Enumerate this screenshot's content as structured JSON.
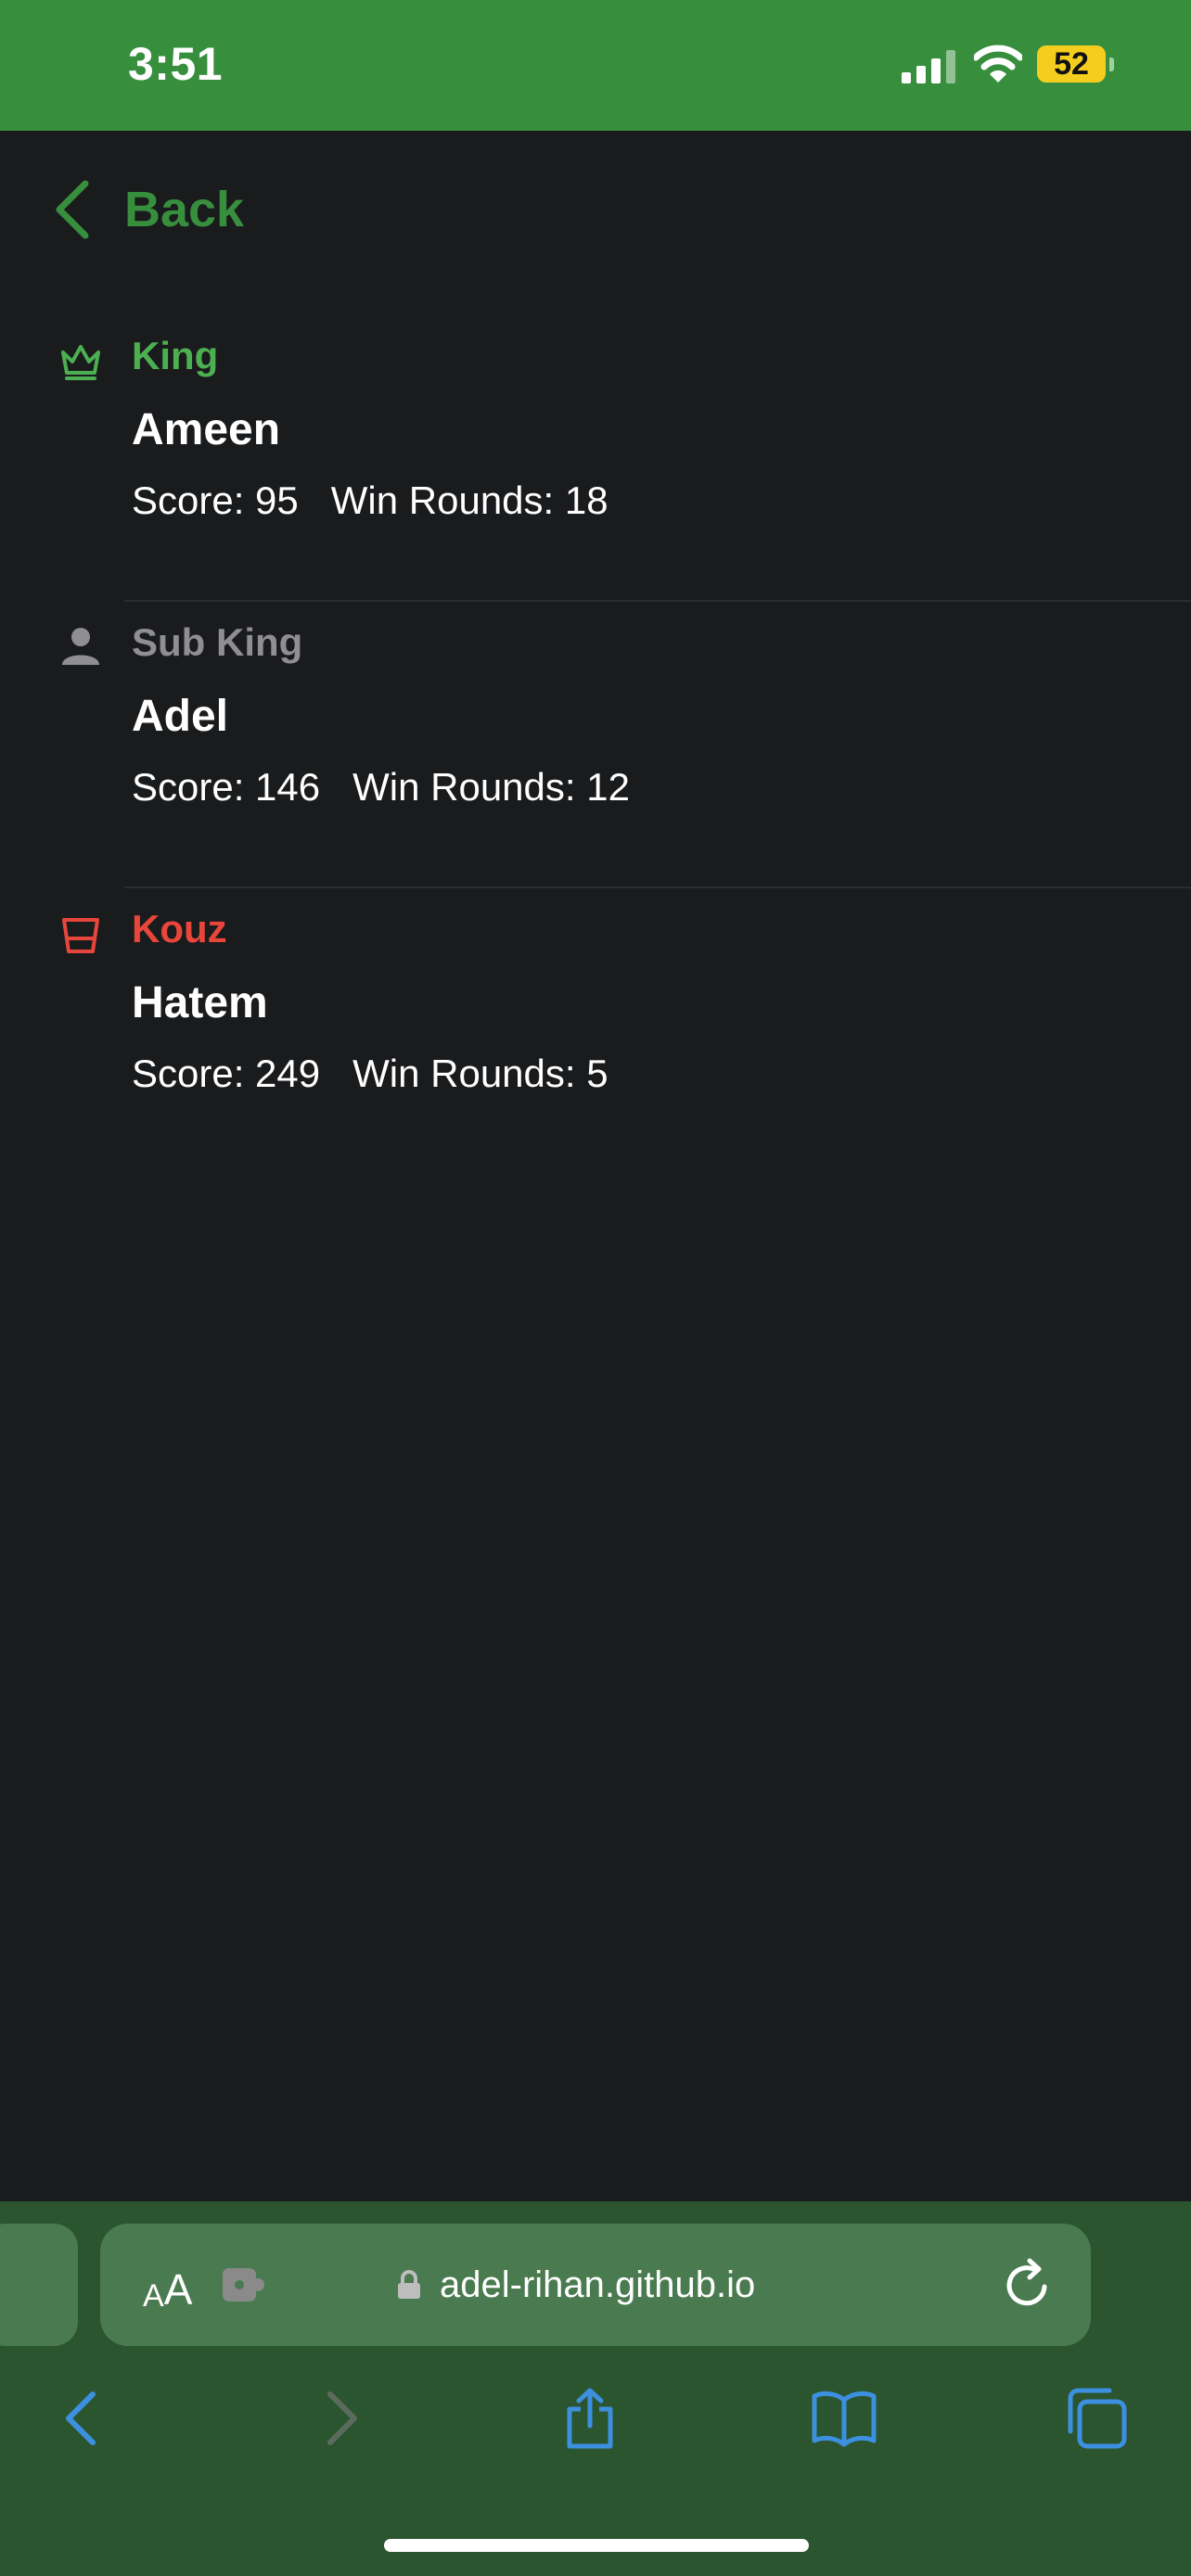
{
  "status_bar": {
    "time": "3:51",
    "battery": "52"
  },
  "header": {
    "back_label": "Back"
  },
  "players": [
    {
      "role": "King",
      "role_color": "#4caf50",
      "icon": "crown-icon",
      "name": "Ameen",
      "stats": "Score: 95   Win Rounds: 18"
    },
    {
      "role": "Sub King",
      "role_color": "#8e8e93",
      "icon": "person-icon",
      "name": "Adel",
      "stats": "Score: 146   Win Rounds: 12"
    },
    {
      "role": "Kouz",
      "role_color": "#e8463b",
      "icon": "cup-icon",
      "name": "Hatem",
      "stats": "Score: 249   Win Rounds: 5"
    }
  ],
  "browser": {
    "aa_small": "A",
    "aa_big": "A",
    "url": "adel-rihan.github.io"
  },
  "colors": {
    "accent": "#378f3d",
    "background": "#1a1b1d",
    "browser_blue": "#3d8fe0"
  }
}
